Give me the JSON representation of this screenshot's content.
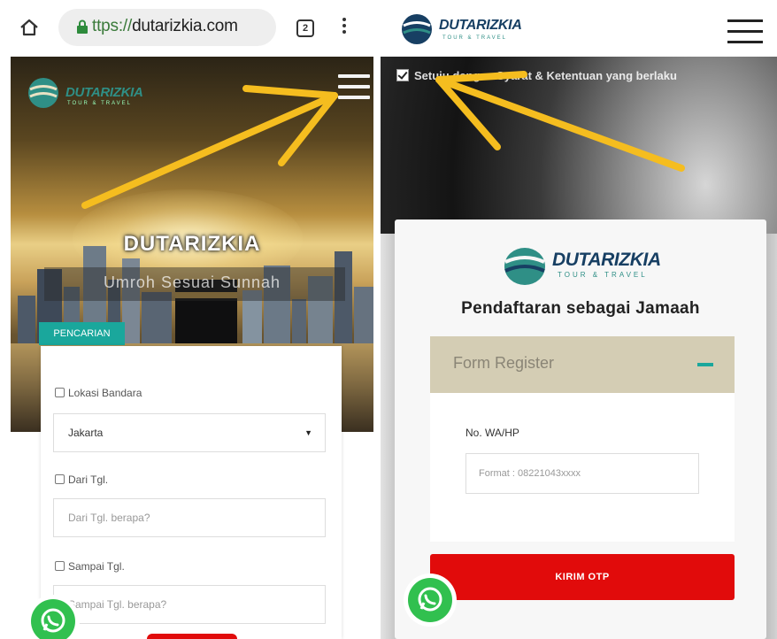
{
  "left": {
    "browser": {
      "url": "ttps://dutarizkia.com",
      "tab_count": "2"
    },
    "hero": {
      "title": "DUTARIZKIA",
      "subtitle": "Umroh Sesuai Sunnah",
      "logo_text": "DUTARIZKIA",
      "logo_subtext": "TOUR & TRAVEL"
    },
    "search": {
      "tab_label": "PENCARIAN",
      "airport_label": "Lokasi Bandara",
      "airport_value": "Jakarta",
      "from_label": "Dari Tgl.",
      "from_placeholder": "Dari Tgl. berapa?",
      "to_label": "Sampai Tgl.",
      "to_placeholder": "Sampai Tgl. berapa?"
    }
  },
  "right": {
    "header": {
      "logo_text": "DUTARIZKIA",
      "logo_subtext": "TOUR & TRAVEL"
    },
    "terms_text": "Setuju dengan Syarat & Ketentuan yang berlaku",
    "register": {
      "logo_text": "DUTARIZKIA",
      "logo_subtext": "TOUR & TRAVEL",
      "title": "Pendaftaran sebagai Jamaah",
      "accordion_title": "Form Register",
      "wa_label": "No. WA/HP",
      "wa_placeholder": "Format : 08221043xxxx",
      "otp_button": "KIRIM OTP"
    }
  },
  "colors": {
    "brand_teal": "#1aa79c",
    "brand_navy": "#173f63",
    "cta_red": "#e10b0b",
    "whatsapp_green": "#31c04f",
    "annotation_arrow": "#f5bd1f"
  }
}
